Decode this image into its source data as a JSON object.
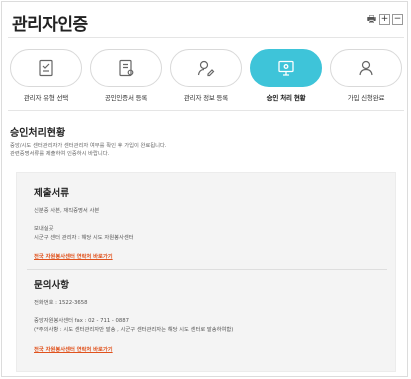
{
  "header": {
    "title": "관리자인증",
    "tools": {
      "print_icon": "print-icon",
      "zoom_in": "+",
      "zoom_out": "−"
    }
  },
  "steps": [
    {
      "label": "관리자 유형 선택",
      "icon": "checklist-icon",
      "active": false
    },
    {
      "label": "공인인증서 등록",
      "icon": "certificate-icon",
      "active": false
    },
    {
      "label": "관리자 정보 등록",
      "icon": "user-edit-icon",
      "active": false
    },
    {
      "label": "승인 처리 현황",
      "icon": "monitor-icon",
      "active": true
    },
    {
      "label": "가입 신청완료",
      "icon": "user-icon",
      "active": false
    }
  ],
  "status": {
    "title": "승인처리현황",
    "desc_line1": "중앙/시도 센터관리자가 센터관리자 여부를 확인 후 가입이 완료됩니다.",
    "desc_line2": "관련증명서류를 제출하여 인증하시 바랍니다."
  },
  "documents": {
    "title": "제출서류",
    "line1": "신분증 사본, 재직증명서 사본",
    "send_label": "보내실곳",
    "send_value": "시군구 센터 관리자 : 해당 시도 자원봉사센터",
    "link": "전국 자원봉사센터 연락처 바로가기"
  },
  "inquiry": {
    "title": "문의사항",
    "phone": "전화번호 : 1522-3658",
    "fax": "중앙자원봉사센터 fax : 02 - 711 - 0887",
    "note": "(*주의사항 : 시도 센터관리자만 발송 , 시군구 센터관리자는 해당 시도 센터로 발송하여함)",
    "link": "전국 자원봉사센터 연락처 바로가기"
  },
  "colors": {
    "accent": "#3ec4d9",
    "link": "#e0521d",
    "card_bg": "#f4f4f4"
  }
}
